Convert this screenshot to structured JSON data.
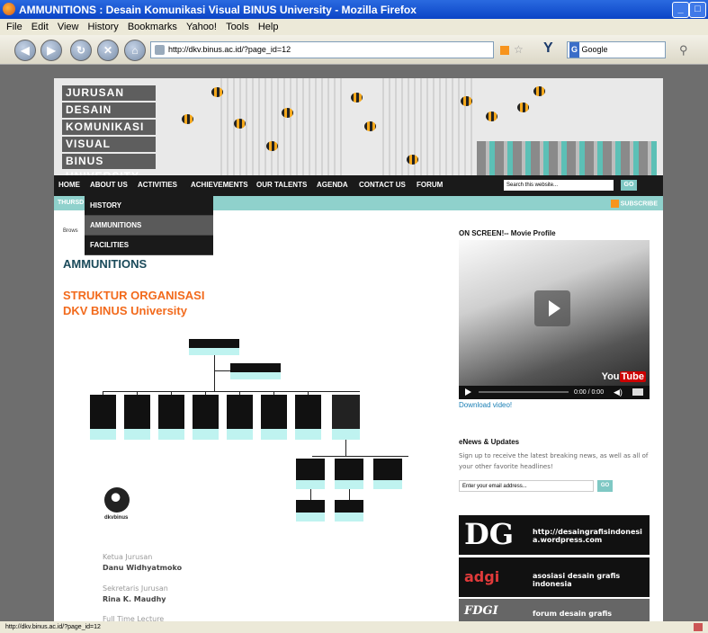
{
  "browser": {
    "title": "AMMUNITIONS : Desain Komunikasi Visual BINUS University - Mozilla Firefox",
    "menu": [
      "File",
      "Edit",
      "View",
      "History",
      "Bookmarks",
      "Yahoo!",
      "Tools",
      "Help"
    ],
    "url": "http://dkv.binus.ac.id/?page_id=12",
    "search_engine": "Google",
    "status": "http://dkv.binus.ac.id/?page_id=12"
  },
  "site": {
    "logo_lines": [
      "JURUSAN",
      "DESAIN",
      "KOMUNIKASI",
      "VISUAL",
      "BINUS UNIVERSITY"
    ],
    "nav": [
      "HOME",
      "ABOUT US",
      "ACTIVITIES",
      "ACHIEVEMENTS",
      "OUR TALENTS",
      "AGENDA",
      "CONTACT US",
      "FORUM"
    ],
    "search_placeholder": "Search this website...",
    "search_button": "GO",
    "date": "THURSD",
    "subscribe": "SUBSCRIBE",
    "dropdown": [
      "HISTORY",
      "AMMUNITIONS",
      "FACILITIES"
    ],
    "browse": "Brows",
    "page_title": "AMMUNITIONS",
    "org_title_1": "STRUKTUR ORGANISASI",
    "org_title_2": "DKV BINUS University",
    "org_logo_text": "dkvbinus",
    "staff": [
      {
        "role": "Ketua Jurusan",
        "name": "Danu Widhyatmoko"
      },
      {
        "role": "Sekretaris Jurusan",
        "name": "Rina K. Maudhy"
      },
      {
        "role": "Full Time Lecture",
        "name": ""
      }
    ]
  },
  "sidebar": {
    "movie_heading": "ON SCREEN!-- Movie Profile",
    "video_time": "0:00 / 0:00",
    "download": "Download video!",
    "enews_heading": "eNews & Updates",
    "enews_desc": "Sign up to receive the latest breaking news, as well as all of your other favorite headlines!",
    "email_placeholder": "Enter your email address...",
    "email_button": "GO",
    "ads": [
      {
        "mark": "DG",
        "text": "http://desaingrafisindonesia.wordpress.com"
      },
      {
        "mark": "adgi",
        "text": "asosiasi desain grafis indonesia"
      },
      {
        "mark": "FDGI",
        "text": "forum desain grafis"
      }
    ]
  }
}
